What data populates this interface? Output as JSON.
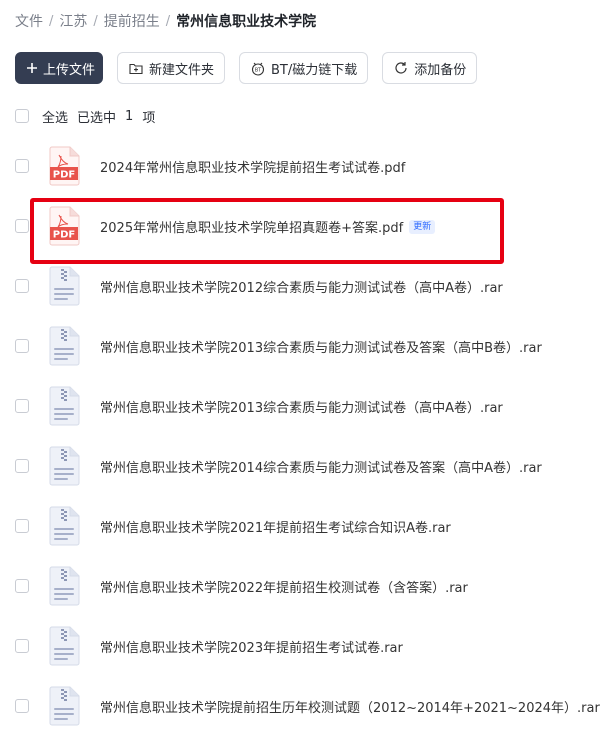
{
  "breadcrumb": {
    "items": [
      "文件",
      "江苏",
      "提前招生"
    ],
    "current": "常州信息职业技术学院",
    "separator": "/"
  },
  "toolbar": {
    "upload_label": "上传文件",
    "new_folder_label": "新建文件夹",
    "bt_label": "BT/磁力链下载",
    "backup_label": "添加备份"
  },
  "selection": {
    "select_all_label": "全选",
    "selected_prefix": "已选中",
    "selected_count": "1",
    "selected_suffix": "项"
  },
  "files": [
    {
      "name": "2024年常州信息职业技术学院提前招生考试试卷.pdf",
      "type": "pdf",
      "icon": "pdf-file-icon"
    },
    {
      "name": "2025年常州信息职业技术学院单招真题卷+答案.pdf",
      "type": "pdf",
      "icon": "pdf-file-icon",
      "badge": "更新",
      "highlighted": true
    },
    {
      "name": "常州信息职业技术学院2012综合素质与能力测试试卷（高中A卷）.rar",
      "type": "rar",
      "icon": "archive-file-icon"
    },
    {
      "name": "常州信息职业技术学院2013综合素质与能力测试试卷及答案（高中B卷）.rar",
      "type": "rar",
      "icon": "archive-file-icon"
    },
    {
      "name": "常州信息职业技术学院2013综合素质与能力测试试卷（高中A卷）.rar",
      "type": "rar",
      "icon": "archive-file-icon"
    },
    {
      "name": "常州信息职业技术学院2014综合素质与能力测试试卷及答案（高中A卷）.rar",
      "type": "rar",
      "icon": "archive-file-icon"
    },
    {
      "name": "常州信息职业技术学院2021年提前招生考试综合知识A卷.rar",
      "type": "rar",
      "icon": "archive-file-icon"
    },
    {
      "name": "常州信息职业技术学院2022年提前招生校测试卷（含答案）.rar",
      "type": "rar",
      "icon": "archive-file-icon"
    },
    {
      "name": "常州信息职业技术学院2023年提前招生考试试卷.rar",
      "type": "rar",
      "icon": "archive-file-icon"
    },
    {
      "name": "常州信息职业技术学院提前招生历年校测试题（2012~2014年+2021~2024年）.rar",
      "type": "rar",
      "icon": "archive-file-icon"
    }
  ],
  "colors": {
    "primary_button": "#343d52",
    "highlight_border": "#e60012",
    "pdf_red": "#e8534b",
    "badge_blue": "#2f6bff"
  }
}
